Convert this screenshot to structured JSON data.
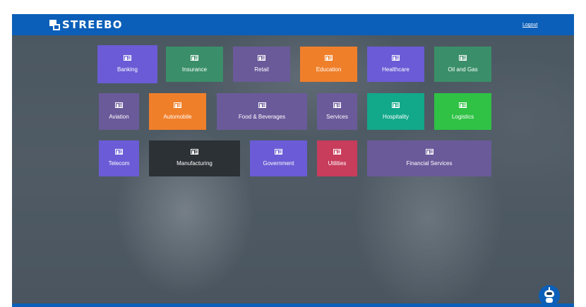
{
  "header": {
    "logo_text": "STREEBO",
    "logout_label": "Logout"
  },
  "tiles": [
    {
      "label": "Banking",
      "color": "#6b5bd6"
    },
    {
      "label": "Insurance",
      "color": "#3a8f6a"
    },
    {
      "label": "Retail",
      "color": "#6a5a9a"
    },
    {
      "label": "Education",
      "color": "#f07f2a"
    },
    {
      "label": "Healthcare",
      "color": "#6b5bd6"
    },
    {
      "label": "Oil and Gas",
      "color": "#3a8f6a"
    },
    {
      "label": "Aviation",
      "color": "#6a5a9a"
    },
    {
      "label": "Automobile",
      "color": "#f07f2a"
    },
    {
      "label": "Food & Beverages",
      "color": "#6a5a9a"
    },
    {
      "label": "Services",
      "color": "#6a5a9a"
    },
    {
      "label": "Hospitality",
      "color": "#12a88a"
    },
    {
      "label": "Logistics",
      "color": "#2fc245"
    },
    {
      "label": "Telecom",
      "color": "#6b5bd6"
    },
    {
      "label": "Manufacturing",
      "color": "#2b3134"
    },
    {
      "label": "Government",
      "color": "#6b5bd6"
    },
    {
      "label": "Utilities",
      "color": "#c83c5c"
    },
    {
      "label": "Financial Services",
      "color": "#6a5a9a"
    }
  ],
  "icons": {
    "tile_icon": "id-card-icon",
    "assistant": "chatbot-icon"
  }
}
